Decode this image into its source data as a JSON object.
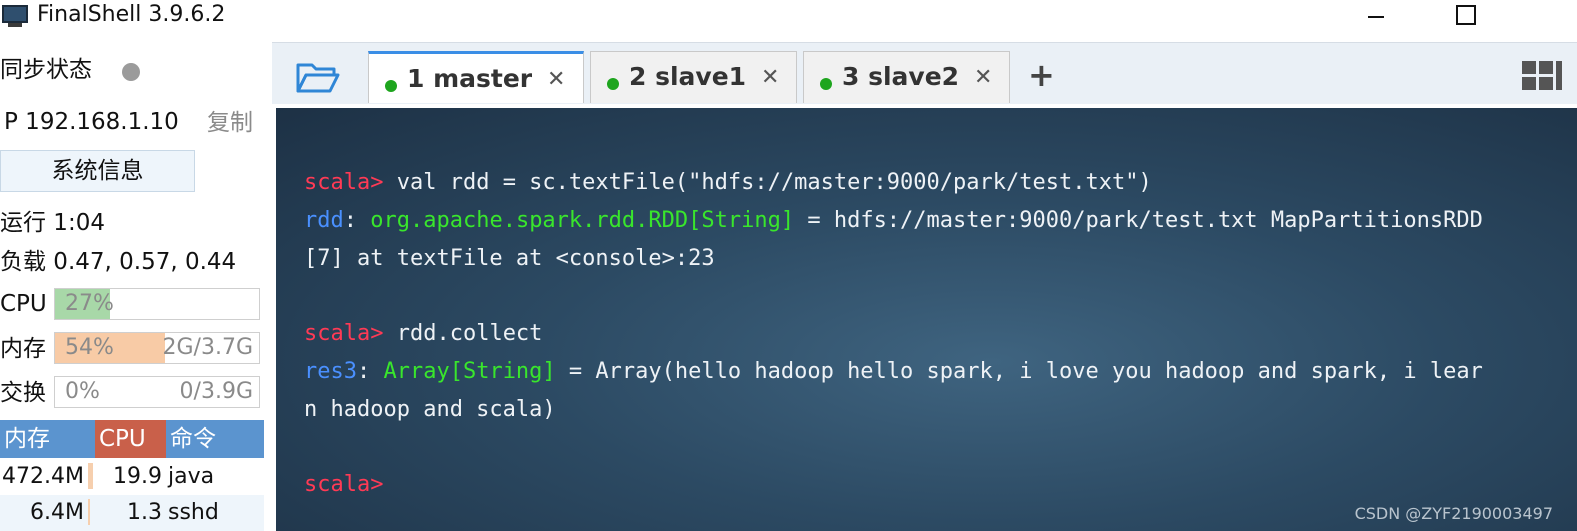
{
  "window": {
    "title": "FinalShell 3.9.6.2",
    "controls": {
      "minimize": "—",
      "maximize": "☐",
      "close": "✕"
    }
  },
  "sidebar": {
    "sync_label": "同步状态",
    "sync_status_color": "#9b9b9b",
    "ip_text": "P 192.168.1.10",
    "copy_label": "复制",
    "sysinfo_button": "系统信息",
    "uptime": "运行 1:04",
    "load": "负载 0.47, 0.57, 0.44",
    "cpu": {
      "label": "CPU",
      "percent_text": "27%",
      "fraction": 0.27,
      "color": "#a8d8a8"
    },
    "memory": {
      "label": "内存",
      "percent_text": "54%",
      "fraction": 0.54,
      "usage_text": "2G/3.7G",
      "color": "#f8cba6"
    },
    "swap": {
      "label": "交换",
      "percent_text": "0%",
      "fraction": 0.0,
      "usage_text": "0/3.9G"
    },
    "process_table": {
      "headers": {
        "mem": "内存",
        "cpu": "CPU",
        "cmd": "命令"
      },
      "rows": [
        {
          "mem": "472.4M",
          "cpu": "19.9",
          "cmd": "java"
        },
        {
          "mem": "6.4M",
          "cpu": "1.3",
          "cmd": "sshd"
        }
      ]
    }
  },
  "tabs": {
    "items": [
      {
        "label": "1 master",
        "active": true,
        "status_color": "#1ea51e"
      },
      {
        "label": "2 slave1",
        "active": false,
        "status_color": "#1ea51e"
      },
      {
        "label": "3 slave2",
        "active": false,
        "status_color": "#1ea51e"
      }
    ],
    "close_glyph": "✕",
    "add_glyph": "+"
  },
  "terminal": {
    "lines": [
      {
        "prompt": "scala>",
        "rest": " val rdd = sc.textFile(\"hdfs://master:9000/park/test.txt\")"
      },
      {
        "var": "rdd",
        "sep": ": ",
        "type": "org.apache.spark.rdd.RDD[String]",
        "rest": " = hdfs://master:9000/park/test.txt MapPartitionsRDD"
      },
      {
        "rest": "[7] at textFile at <console>:23"
      },
      {
        "prompt": "scala>",
        "rest": " rdd.collect"
      },
      {
        "var": "res3",
        "sep": ": ",
        "type": "Array[String]",
        "rest": " = Array(hello hadoop hello spark, i love you hadoop and spark, i lear"
      },
      {
        "rest": "n hadoop and scala)"
      },
      {
        "prompt": "scala>"
      }
    ],
    "watermark": "CSDN @ZYF2190003497"
  }
}
